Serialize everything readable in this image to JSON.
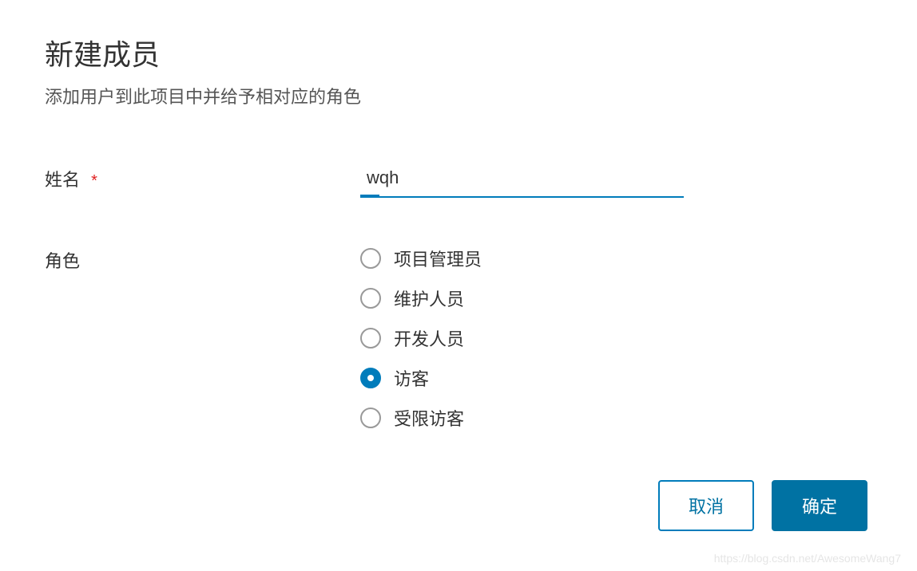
{
  "dialog": {
    "title": "新建成员",
    "subtitle": "添加用户到此项目中并给予相对应的角色"
  },
  "form": {
    "name": {
      "label": "姓名",
      "required_mark": "*",
      "value": "wqh"
    },
    "role": {
      "label": "角色",
      "options": [
        {
          "label": "项目管理员",
          "selected": false
        },
        {
          "label": "维护人员",
          "selected": false
        },
        {
          "label": "开发人员",
          "selected": false
        },
        {
          "label": "访客",
          "selected": true
        },
        {
          "label": "受限访客",
          "selected": false
        }
      ]
    }
  },
  "buttons": {
    "cancel": "取消",
    "confirm": "确定"
  },
  "watermark": "https://blog.csdn.net/AwesomeWang7"
}
